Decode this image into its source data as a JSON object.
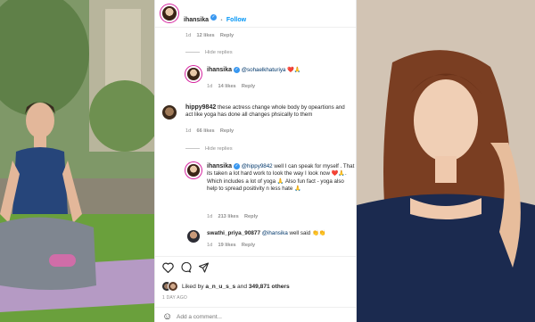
{
  "post": {
    "author": "ihansika",
    "follow_label": "Follow",
    "dot": "•"
  },
  "comments": [
    {
      "id": "c0",
      "time": "1d",
      "likes": "12 likes",
      "reply": "Reply"
    },
    {
      "id": "hide1",
      "hide_label": "Hide replies"
    },
    {
      "id": "c1",
      "user": "ihansika",
      "mention": "@sohaelkhaturiya",
      "text": "❤️🙏",
      "time": "1d",
      "likes": "14 likes",
      "reply": "Reply"
    },
    {
      "id": "c2",
      "user": "hippy9842",
      "text": "these actress change whole body by opeartions and act like yoga has done all changes phsically to them",
      "time": "1d",
      "likes": "66 likes",
      "reply": "Reply"
    },
    {
      "id": "hide2",
      "hide_label": "Hide replies"
    },
    {
      "id": "c3",
      "user": "ihansika",
      "mention": "@hippy9842",
      "text": "well I can speak for myself . That its taken a lot hard work to look the way I look now ❤️🙏. Which includes a lot of yoga 🙏 Also fun fact - yoga also help to spread positivity n less hate 🙏",
      "time": "1d",
      "likes": "213 likes",
      "reply": "Reply"
    },
    {
      "id": "c4",
      "user": "swathi_priya_90877",
      "mention": "@ihansika",
      "text": "well said 👏👏",
      "time": "1d",
      "likes": "19 likes",
      "reply": "Reply"
    }
  ],
  "footer": {
    "liked_by_prefix": "Liked by",
    "liked_by_user": "a_n_u_s_s",
    "liked_by_and": "and",
    "liked_by_count": "349,871 others",
    "timestamp": "1 DAY AGO",
    "add_comment_placeholder": "Add a comment..."
  },
  "icons": [
    "heart-icon",
    "comment-icon",
    "share-icon",
    "verified-icon"
  ],
  "colors": {
    "link": "#00376b",
    "follow": "#0095f6",
    "verified": "#3897f0",
    "muted": "#8e8e8e"
  }
}
